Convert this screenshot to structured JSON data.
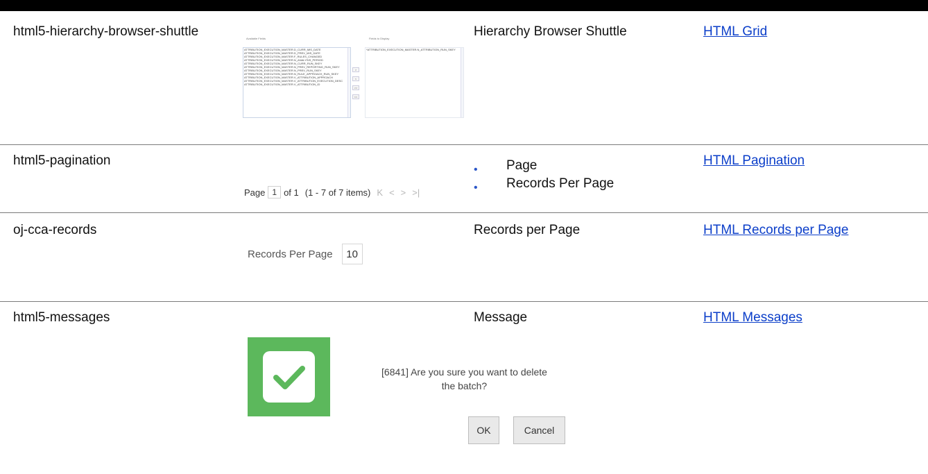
{
  "rows": [
    {
      "name": "html5-hierarchy-browser-shuttle",
      "description": "Hierarchy Browser Shuttle",
      "link": "HTML Grid"
    },
    {
      "name": "html5-pagination",
      "bullets": [
        "Page",
        "Records Per Page"
      ],
      "link": "HTML Pagination"
    },
    {
      "name": "oj-cca-records",
      "description": "Records per Page",
      "link": "HTML Records per Page"
    },
    {
      "name": "html5-messages",
      "description": "Message",
      "link": "HTML Messages"
    }
  ],
  "shuttle": {
    "available_caption": "Available Fields",
    "display_caption": "Fields to Display",
    "available_items": [
      "ATTRIBUTION_EXECUTION_MASTER.D_CURR_MIS_DATE",
      "ATTRIBUTION_EXECUTION_MASTER.D_PREV_MIS_DATE",
      "ATTRIBUTION_EXECUTION_MASTER.F_RULES_CHANGED",
      "ATTRIBUTION_EXECUTION_MASTER.N_ANALYSIS_PERIOD",
      "ATTRIBUTION_EXECUTION_MASTER.N_CURR_RUN_SKEY",
      "ATTRIBUTION_EXECUTION_MASTER.N_PREV_REPORTING_RUN_SKEY",
      "ATTRIBUTION_EXECUTION_MASTER.N_PREV_RUN_SKEY",
      "ATTRIBUTION_EXECUTION_MASTER.N_RULE_APPROACH_RUN_SKEY",
      "ATTRIBUTION_EXECUTION_MASTER.V_ATTRIBUTION_APPROACH",
      "ATTRIBUTION_EXECUTION_MASTER.V_ATTRIBUTION_EXECUTION_DESC",
      "ATTRIBUTION_EXECUTION_MASTER.V_ATTRIBUTION_ID"
    ],
    "display_items": [
      "*ATTRIBUTION_EXECUTION_MASTER.N_ATTRIBUTION_RUN_SKEY"
    ],
    "buttons": [
      ">",
      "<",
      ">>",
      "<<"
    ]
  },
  "pagination": {
    "page_label": "Page",
    "current_page": "1",
    "of_label": "of 1",
    "range_label": "(1 - 7 of  7  items)"
  },
  "records": {
    "label": "Records Per Page",
    "value": "10"
  },
  "message": {
    "text": "[6841] Are you sure you want to delete the batch?",
    "ok_label": "OK",
    "cancel_label": "Cancel",
    "icon_color": "#5cb85c"
  }
}
